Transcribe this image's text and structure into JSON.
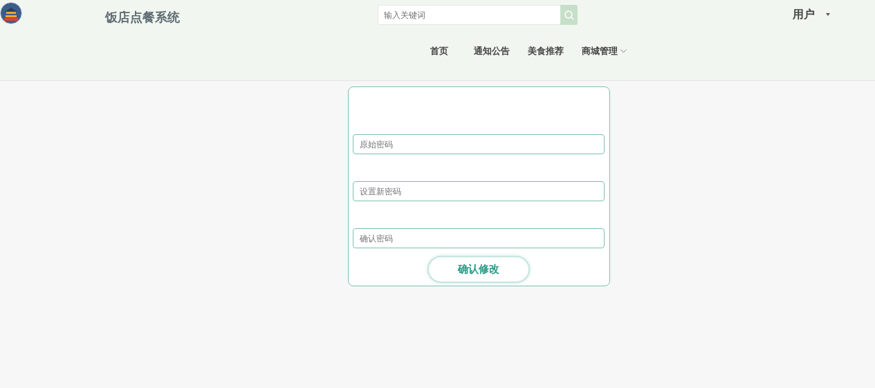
{
  "header": {
    "title": "饭店点餐系统",
    "search": {
      "placeholder": "输入关键词"
    },
    "user": "用户"
  },
  "nav": [
    {
      "label": "首页",
      "dropdown": false
    },
    {
      "label": "通知公告",
      "dropdown": false
    },
    {
      "label": "美食推荐",
      "dropdown": false
    },
    {
      "label": "商城管理",
      "dropdown": true
    }
  ],
  "form": {
    "fields": [
      {
        "placeholder": "原始密码"
      },
      {
        "placeholder": "设置新密码"
      },
      {
        "placeholder": "确认密码"
      }
    ],
    "submit": "确认修改"
  }
}
